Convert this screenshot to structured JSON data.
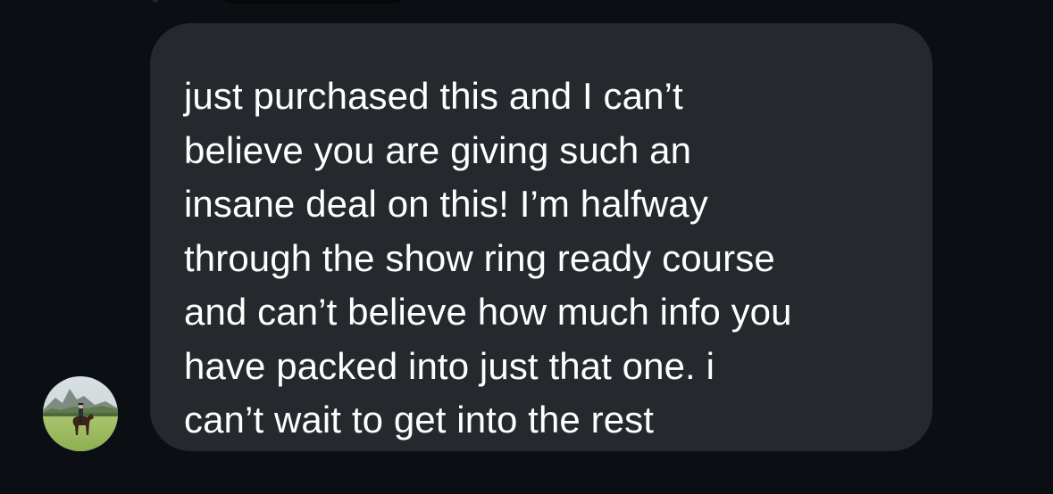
{
  "conversation": {
    "incoming_message": {
      "text": "just purchased this and I can’t\nbelieve you are giving such an\ninsane deal on this! I’m halfway\nthrough the show ring ready course\nand can’t believe how much info you\nhave packed into just that one. i\ncan’t wait to get into the rest"
    },
    "sender_avatar": {
      "icon": "profile-photo-horse-rider"
    }
  },
  "colors": {
    "background": "#0b0f14",
    "bubble": "#25282d",
    "text": "#ffffff"
  }
}
